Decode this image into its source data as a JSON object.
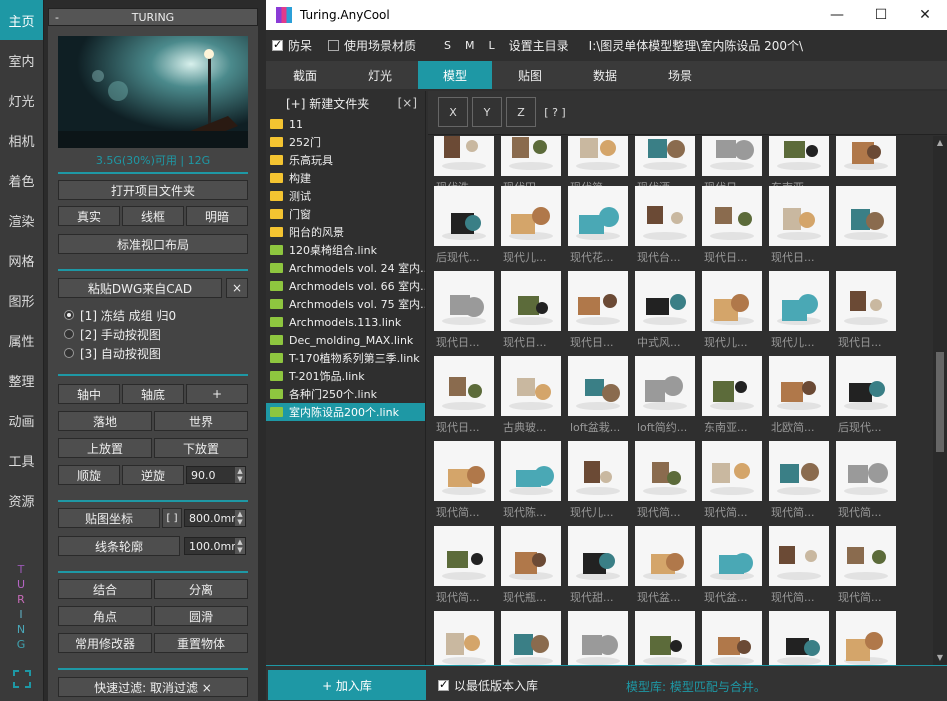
{
  "leftnav": {
    "items": [
      "主页",
      "室内",
      "灯光",
      "相机",
      "着色",
      "渲染",
      "网格",
      "图形",
      "属性",
      "整理",
      "动画",
      "工具",
      "资源"
    ],
    "active_index": 0,
    "vertical_brand": [
      "T",
      "U",
      "R",
      "I",
      "N",
      "G"
    ]
  },
  "panel": {
    "minus": "-",
    "title": "TURING",
    "usage": "3.5G(30%)可用 | 12G",
    "buttons": {
      "open_project": "打开项目文件夹",
      "real": "真实",
      "wire": "线框",
      "bright": "明暗",
      "std_viewport": "标准视口布局",
      "paste_dwg": "粘贴DWG来自CAD",
      "close": "×",
      "axis_center": "轴中",
      "axis_bottom": "轴底",
      "plus": "+",
      "drop": "落地",
      "world": "世界",
      "place_up": "上放置",
      "place_down": "下放置",
      "cw": "顺旋",
      "ccw": "逆旋",
      "map_coord": "贴图坐标",
      "bracket": "[ ]",
      "line_outline": "线条轮廓",
      "attach": "结合",
      "detach": "分离",
      "corner": "角点",
      "smooth": "圆滑",
      "common_mod": "常用修改器",
      "reset_obj": "重置物体",
      "quick_filter": "快速过滤: 取消过滤 ×"
    },
    "radios": [
      {
        "label": "[1] 冻结 成组 归0",
        "selected": true
      },
      {
        "label": "[2] 手动按视图",
        "selected": false
      },
      {
        "label": "[3] 自动按视图",
        "selected": false
      }
    ],
    "rotate_value": "90.0",
    "map_value": "800.0mm",
    "line_value": "100.0mm"
  },
  "window": {
    "title": "Turing.AnyCool",
    "controls": {
      "min": "—",
      "max": "☐",
      "close": "✕"
    },
    "options": {
      "fall_prevent": "防呆",
      "fall_prevent_checked": true,
      "use_scene_mat": "使用场景材质",
      "use_scene_mat_checked": false,
      "size_s": "S",
      "size_m": "M",
      "size_l": "L",
      "set_root": "设置主目录",
      "path": "I:\\图灵单体模型整理\\室内陈设品 200个\\"
    },
    "tabs": [
      "截面",
      "灯光",
      "模型",
      "贴图",
      "数据",
      "场景"
    ],
    "active_tab": 2
  },
  "filepane": {
    "new_folder": "[+] 新建文件夹",
    "close": "[×]",
    "items": [
      {
        "name": "11",
        "type": "folder"
      },
      {
        "name": "252门",
        "type": "folder"
      },
      {
        "name": "乐高玩具",
        "type": "folder"
      },
      {
        "name": "构建",
        "type": "folder"
      },
      {
        "name": "测试",
        "type": "folder"
      },
      {
        "name": "门窗",
        "type": "folder"
      },
      {
        "name": "阳台的风景",
        "type": "folder"
      },
      {
        "name": "120桌椅组合.link",
        "type": "link"
      },
      {
        "name": "Archmodels vol. 24 室内...",
        "type": "link"
      },
      {
        "name": "Archmodels vol. 66 室内...",
        "type": "link"
      },
      {
        "name": "Archmodels vol. 75 室内...",
        "type": "link"
      },
      {
        "name": "Archmodels.113.link",
        "type": "link"
      },
      {
        "name": "Dec_molding_MAX.link",
        "type": "link"
      },
      {
        "name": "T-170植物系列第三季.link",
        "type": "link"
      },
      {
        "name": "T-201饰品.link",
        "type": "link"
      },
      {
        "name": "各种门250个.link",
        "type": "link"
      },
      {
        "name": "室内陈设品200个.link",
        "type": "link",
        "selected": true
      }
    ]
  },
  "axisbar": {
    "x": "X",
    "y": "Y",
    "z": "Z",
    "help": "[ ? ]"
  },
  "gallery": {
    "rows": [
      [
        "现代洗...",
        "现代田...",
        "现代简...",
        "现代酒...",
        "现代日...",
        "东南亚..."
      ],
      [
        "后现代...",
        "现代儿...",
        "现代花...",
        "现代台...",
        "现代日...",
        "现代日..."
      ],
      [
        "现代日...",
        "现代日...",
        "现代日...",
        "中式风...",
        "现代儿...",
        "现代儿...",
        "现代日..."
      ],
      [
        "现代日...",
        "古典玻...",
        "loft盆栽...",
        "loft简约...",
        "东南亚...",
        "北欧简...",
        "后现代..."
      ],
      [
        "现代简...",
        "现代陈...",
        "现代儿...",
        "现代简...",
        "现代简...",
        "现代简...",
        "现代简..."
      ],
      [
        "现代简...",
        "现代瓶...",
        "现代甜...",
        "现代盆...",
        "现代盆...",
        "现代简...",
        "现代简..."
      ],
      [
        "",
        "",
        "",
        "",
        "",
        "",
        ""
      ]
    ],
    "colors": {
      "accent": "#1e98a5",
      "folder": "#f4c431",
      "link": "#8ec63f"
    }
  },
  "bottombar": {
    "add_lib": "+ 加入库",
    "low_version": "以最低版本入库",
    "low_version_checked": true,
    "status": "模型库: 模型匹配与合并。"
  }
}
